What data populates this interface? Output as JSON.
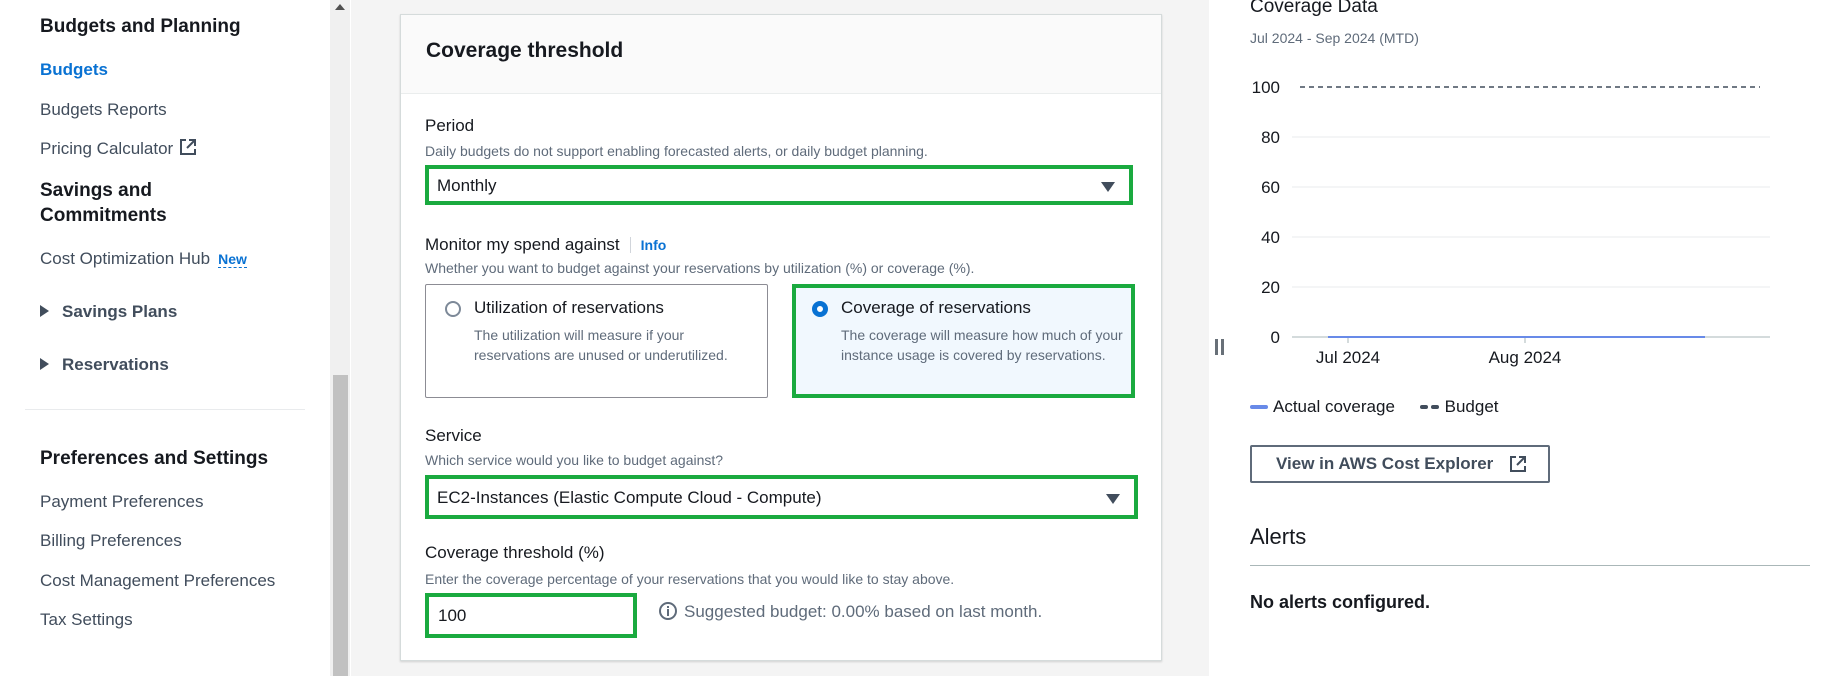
{
  "sidebar": {
    "budgets_planning_heading": "Budgets and Planning",
    "budgets": "Budgets",
    "budgets_reports": "Budgets Reports",
    "pricing_calculator": "Pricing Calculator",
    "savings_heading_line1": "Savings and",
    "savings_heading_line2": "Commitments",
    "cost_optimization_hub": "Cost Optimization Hub",
    "new_badge": "New",
    "savings_plans": "Savings Plans",
    "reservations": "Reservations",
    "preferences_heading": "Preferences and Settings",
    "payment_preferences": "Payment Preferences",
    "billing_preferences": "Billing Preferences",
    "cost_management_preferences": "Cost Management Preferences",
    "tax_settings": "Tax Settings"
  },
  "form": {
    "title": "Coverage threshold",
    "period": {
      "label": "Period",
      "description": "Daily budgets do not support enabling forecasted alerts, or daily budget planning.",
      "value": "Monthly"
    },
    "monitor": {
      "label": "Monitor my spend against",
      "info": "Info",
      "description": "Whether you want to budget against your reservations by utilization (%) or coverage (%).",
      "options": [
        {
          "title": "Utilization of reservations",
          "desc": "The utilization will measure if your reservations are unused or underutilized.",
          "selected": false
        },
        {
          "title": "Coverage of reservations",
          "desc": "The coverage will measure how much of your instance usage is covered by reservations.",
          "selected": true
        }
      ]
    },
    "service": {
      "label": "Service",
      "description": "Which service would you like to budget against?",
      "value": "EC2-Instances (Elastic Compute Cloud - Compute)"
    },
    "threshold": {
      "label": "Coverage threshold (%)",
      "description": "Enter the coverage percentage of your reservations that you would like to stay above.",
      "value": "100",
      "suggestion": "Suggested budget: 0.00% based on last month."
    }
  },
  "panel": {
    "title": "Coverage Data",
    "subtitle": "Jul 2024 - Sep 2024 (MTD)",
    "view_button": "View in AWS Cost Explorer",
    "alerts_title": "Alerts",
    "alerts_empty": "No alerts configured."
  },
  "chart_data": {
    "type": "line",
    "x_ticks": [
      "Jul 2024",
      "Aug 2024"
    ],
    "y_ticks": [
      0,
      20,
      40,
      60,
      80,
      100
    ],
    "ylim": [
      0,
      100
    ],
    "grid": true,
    "legend_position": "bottom-left",
    "series": [
      {
        "name": "Actual coverage",
        "style": "solid",
        "color": "#688ae8",
        "values": [
          0,
          0,
          0
        ]
      },
      {
        "name": "Budget",
        "style": "dashed",
        "color": "#414d5c",
        "values": [
          100,
          100,
          100
        ]
      }
    ]
  }
}
